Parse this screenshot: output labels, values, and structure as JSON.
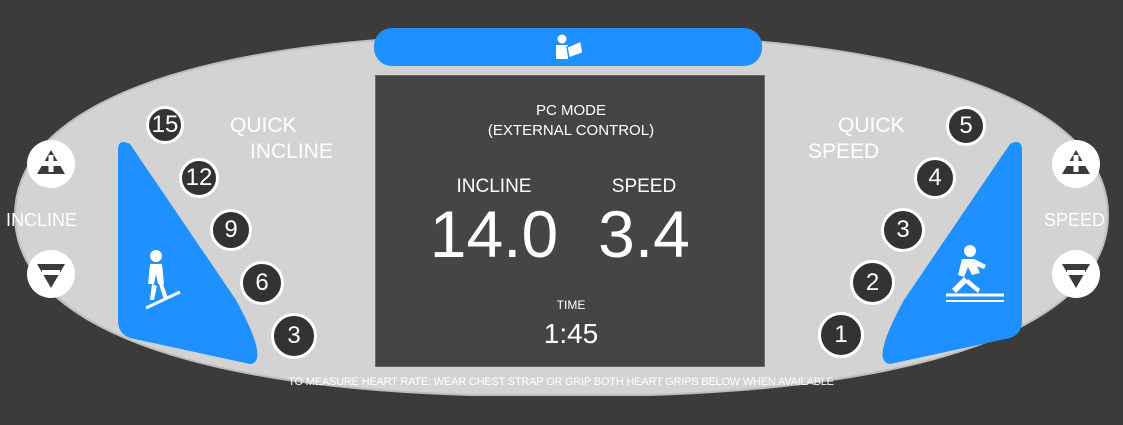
{
  "colors": {
    "background": "#3b3b3b",
    "panel": "#d3d3d3",
    "accent_blue": "#1e90ff",
    "screen": "#454545",
    "button_fill": "#333333"
  },
  "top_bar": {
    "icon": "manual-reader-icon"
  },
  "left": {
    "side_label": "INCLINE",
    "quick_title_1": "QUICK",
    "quick_title_2": "INCLINE",
    "quick_buttons": [
      "15",
      "12",
      "9",
      "6",
      "3"
    ],
    "plus_icon": "plus-icon",
    "minus_icon": "minus-icon",
    "panel_icon": "incline-walker-icon"
  },
  "right": {
    "side_label": "SPEED",
    "quick_title_1": "QUICK",
    "quick_title_2": "SPEED",
    "quick_buttons": [
      "5",
      "4",
      "3",
      "2",
      "1"
    ],
    "plus_icon": "plus-icon",
    "minus_icon": "minus-icon",
    "panel_icon": "runner-icon"
  },
  "display": {
    "mode_line_1": "PC MODE",
    "mode_line_2": "(EXTERNAL CONTROL)",
    "incline_label": "INCLINE",
    "incline_value": "14.0",
    "speed_label": "SPEED",
    "speed_value": "3.4",
    "time_label": "TIME",
    "time_value": "1:45"
  },
  "footer_text": "TO MEASURE HEART RATE: WEAR CHEST STRAP OR GRIP BOTH HEART GRIPS BELOW WHEN AVAILABLE"
}
